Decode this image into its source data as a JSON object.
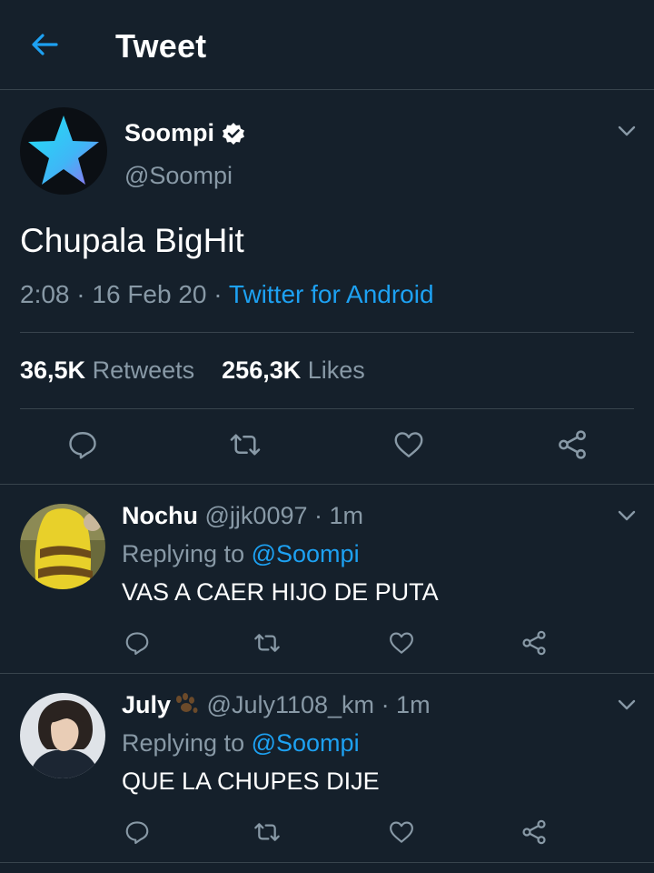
{
  "header": {
    "title": "Tweet"
  },
  "tweet": {
    "display_name": "Soompi",
    "handle": "@Soompi",
    "text": "Chupala BigHit",
    "time": "2:08",
    "date": "16 Feb 20",
    "separator": "·",
    "source": "Twitter for Android",
    "retweets_count": "36,5K",
    "retweets_label": "Retweets",
    "likes_count": "256,3K",
    "likes_label": "Likes"
  },
  "replies": [
    {
      "name": "Nochu",
      "handle": "@jjk0097",
      "time": "· 1m",
      "replying_label": "Replying to",
      "replying_to": "@Soompi",
      "text": "VAS A CAER HIJO DE PUTA"
    },
    {
      "name": "July",
      "handle": "@July1108_km",
      "time": "· 1m",
      "replying_label": "Replying to",
      "replying_to": "@Soompi",
      "text": "QUE LA CHUPES DIJE"
    }
  ],
  "colors": {
    "background": "#15202b",
    "accent": "#1da1f2",
    "secondary_text": "#8899a6",
    "divider": "#38444d"
  },
  "icons": [
    "arrow-left-icon",
    "verified-badge-icon",
    "chevron-down-icon",
    "reply-icon",
    "retweet-icon",
    "heart-icon",
    "share-icon",
    "paw-emoji-icon"
  ]
}
